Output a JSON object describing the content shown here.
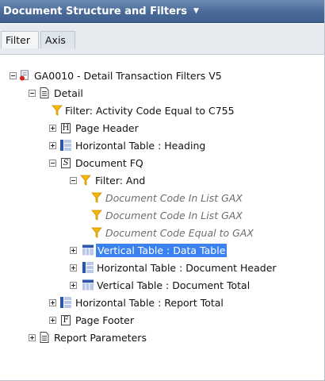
{
  "panel": {
    "title": "Document Structure and Filters"
  },
  "tabs": [
    {
      "label": "Filter"
    },
    {
      "label": "Axis"
    }
  ],
  "tree": [
    {
      "label": "GA0010 - Detail Transaction Filters V5",
      "icon": "report-icon",
      "expander": "minus"
    },
    {
      "label": "Detail",
      "icon": "document-icon",
      "expander": "minus"
    },
    {
      "label": "Filter: Activity Code Equal to C755",
      "icon": "filter-icon",
      "expander": "none"
    },
    {
      "label": "Page Header",
      "icon": "H",
      "expander": "plus"
    },
    {
      "label": "Horizontal Table : Heading",
      "icon": "horizontal-table-icon",
      "expander": "plus"
    },
    {
      "label": "Document FQ",
      "icon": "S",
      "expander": "minus"
    },
    {
      "label": "Filter: And",
      "icon": "filter-icon",
      "expander": "minus"
    },
    {
      "label": "Document Code In List GAX",
      "icon": "filter-icon",
      "expander": "none"
    },
    {
      "label": "Document Code In List GAX",
      "icon": "filter-icon",
      "expander": "none"
    },
    {
      "label": "Document Code Equal to GAX",
      "icon": "filter-icon",
      "expander": "none"
    },
    {
      "label": "Vertical Table : Data Table",
      "icon": "vertical-table-icon",
      "expander": "plus",
      "selected": true
    },
    {
      "label": "Horizontal Table : Document Header",
      "icon": "horizontal-table-icon",
      "expander": "plus"
    },
    {
      "label": "Vertical Table : Document Total",
      "icon": "vertical-table-icon",
      "expander": "plus"
    },
    {
      "label": "Horizontal Table : Report Total",
      "icon": "horizontal-table-icon",
      "expander": "plus"
    },
    {
      "label": "Page Footer",
      "icon": "F",
      "expander": "plus"
    },
    {
      "label": "Report Parameters",
      "icon": "document-icon",
      "expander": "plus"
    }
  ],
  "colors": {
    "title_bar": "#4a6a98",
    "selection": "#3b82f0",
    "filter_icon": "#f2b705"
  }
}
